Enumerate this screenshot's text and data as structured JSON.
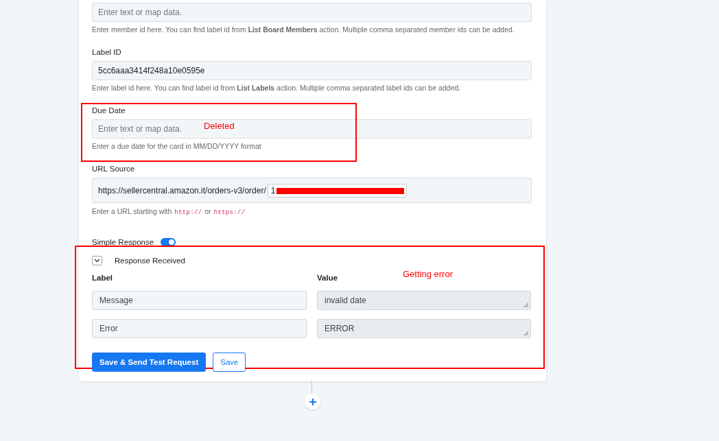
{
  "fields": [
    {
      "kind": "text",
      "placeholder": "Enter text or map data.",
      "help": "Enter member id here. You can find label id from **List Board Members** action. Multiple comma separated member ids can be added."
    },
    {
      "kind": "text",
      "label": "Label ID",
      "value": "5cc6aaa3414f248a10e0595e",
      "help": "Enter label id here. You can find label id from **List Labels** action. Multiple comma separated label ids can be added."
    },
    {
      "kind": "text",
      "label": "Due Date",
      "placeholder": "Enter text or map data.",
      "help": "Enter a due date for the card in MM/DD/YYYY format"
    },
    {
      "kind": "url",
      "label": "URL Source",
      "prefix": "https://sellercentral.amazon.it/orders-v3/order/",
      "value": "1",
      "redacted": true,
      "help_parts": [
        {
          "kind": "text",
          "text": "Enter a URL starting with"
        },
        {
          "kind": "code",
          "text": "http://"
        },
        {
          "kind": "text",
          "text": "or"
        },
        {
          "kind": "code",
          "text": "https://"
        }
      ]
    }
  ],
  "simple_response": {
    "label": "Simple Response",
    "on": true
  },
  "response": {
    "title": "Response Received",
    "expanded": true,
    "label_header": "Label",
    "value_header": "Value",
    "rows": [
      {
        "label": "Message",
        "value": "invalid date"
      },
      {
        "label": "Error",
        "value": "ERROR"
      }
    ]
  },
  "buttons": [
    {
      "kind": "primary",
      "label": "Save & Send Test Request"
    },
    {
      "kind": "outline",
      "label": "Save"
    }
  ],
  "annotations": [
    {
      "text": "Deleted"
    },
    {
      "text": "Getting error"
    }
  ]
}
